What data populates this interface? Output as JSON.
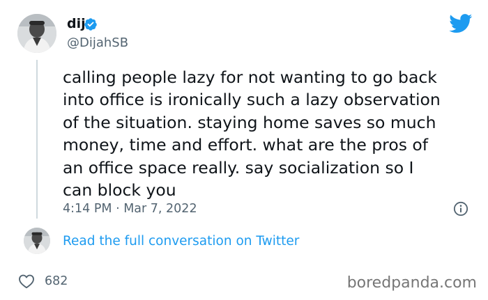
{
  "author": {
    "name": "dij",
    "handle": "@DijahSB",
    "verified_icon": "verified-badge-icon",
    "avatar_icon": "profile-photo"
  },
  "platform_icon": "twitter-bird-icon",
  "tweet": {
    "lines": [
      "calling people lazy for not wanting to go back",
      "into office is ironically such a lazy observation",
      "of the situation. staying home saves so much",
      "money, time and effort. what are the pros of",
      "an office space really. say socialization so I",
      "can block you"
    ],
    "timestamp": "4:14 PM · Mar 7, 2022",
    "info_icon": "info-icon"
  },
  "conversation_link": "Read the full conversation on Twitter",
  "likes": {
    "icon": "heart-icon",
    "count": "682"
  },
  "watermark": "boredpanda.com",
  "colors": {
    "link": "#1d9bf0",
    "secondary_text": "#536471",
    "primary_text": "#0f1419",
    "thread_line": "#cfd9de",
    "watermark": "#767676"
  }
}
